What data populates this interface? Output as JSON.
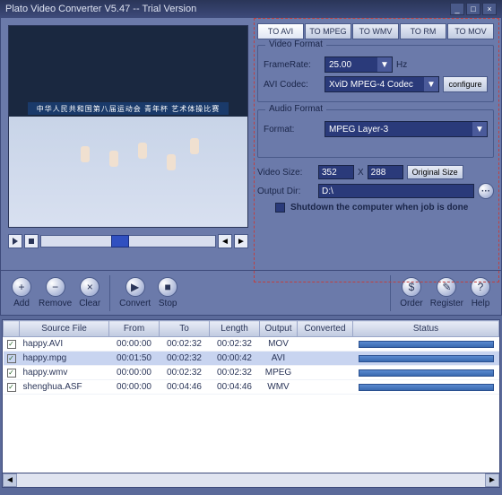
{
  "window": {
    "title": "Plato Video Converter V5.47 -- Trial Version"
  },
  "tabs": [
    "TO AVI",
    "TO MPEG",
    "TO WMV",
    "TO RM",
    "TO MOV"
  ],
  "active_tab": 0,
  "video_format": {
    "legend": "Video Format",
    "framerate_label": "FrameRate:",
    "framerate_value": "25.00",
    "framerate_unit": "Hz",
    "codec_label": "AVI Codec:",
    "codec_value": "XviD MPEG-4 Codec",
    "configure_label": "configure"
  },
  "audio_format": {
    "legend": "Audio Format",
    "format_label": "Format:",
    "format_value": "MPEG Layer-3"
  },
  "video_size": {
    "label": "Video Size:",
    "width": "352",
    "height": "288",
    "mult": "X",
    "original_label": "Original Size"
  },
  "output": {
    "label": "Output Dir:",
    "value": "D:\\"
  },
  "shutdown_label": "Shutdown the computer when job is done",
  "toolbar": {
    "add": "Add",
    "remove": "Remove",
    "clear": "Clear",
    "convert": "Convert",
    "stop": "Stop",
    "order": "Order",
    "register": "Register",
    "help": "Help"
  },
  "columns": [
    "",
    "Source File",
    "From",
    "To",
    "Length",
    "Output",
    "Converted",
    "Status"
  ],
  "rows": [
    {
      "checked": true,
      "source": "happy.AVI",
      "from": "00:00:00",
      "to": "00:02:32",
      "length": "00:02:32",
      "output": "MOV",
      "converted": ""
    },
    {
      "checked": true,
      "source": "happy.mpg",
      "from": "00:01:50",
      "to": "00:02:32",
      "length": "00:00:42",
      "output": "AVI",
      "converted": "",
      "selected": true
    },
    {
      "checked": true,
      "source": "happy.wmv",
      "from": "00:00:00",
      "to": "00:02:32",
      "length": "00:02:32",
      "output": "MPEG",
      "converted": ""
    },
    {
      "checked": true,
      "source": "shenghua.ASF",
      "from": "00:00:00",
      "to": "00:04:46",
      "length": "00:04:46",
      "output": "WMV",
      "converted": ""
    }
  ],
  "preview_banner": "中华人民共和国第八届运动会 青年杯 艺术体操比赛"
}
